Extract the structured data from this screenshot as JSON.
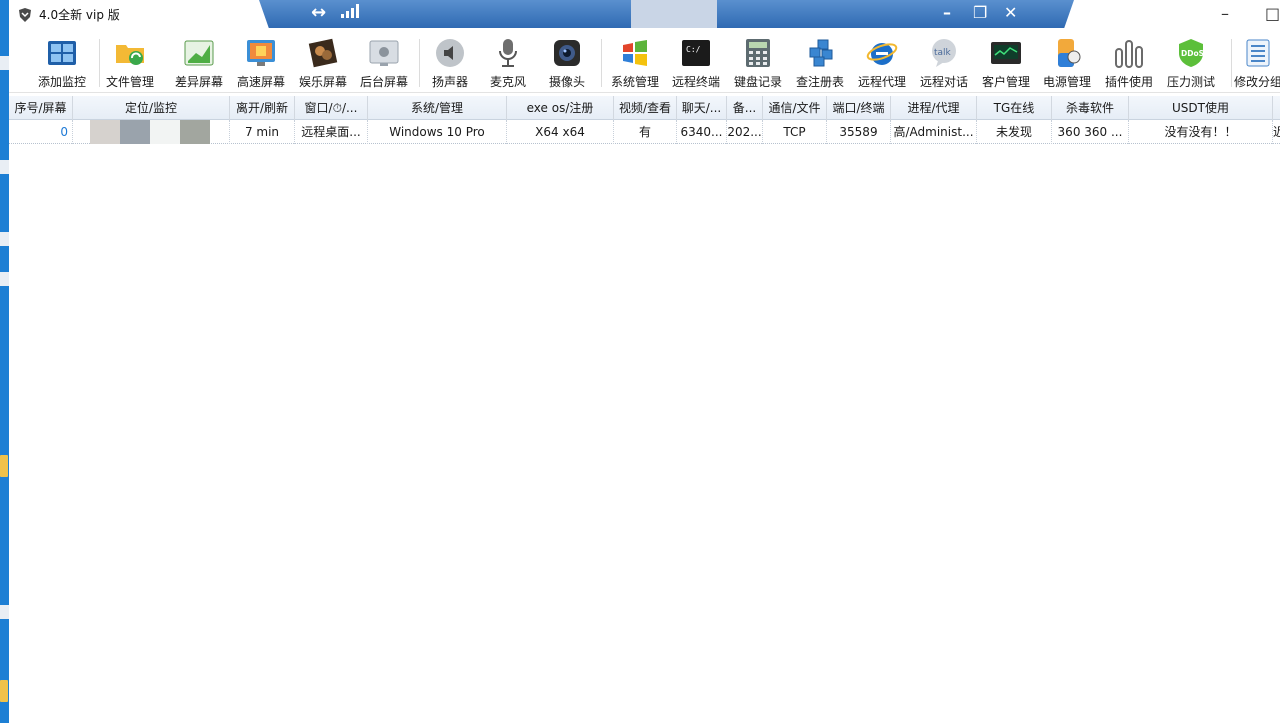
{
  "window": {
    "title": "4.0全新 vip 版",
    "remote_bar": {
      "pin": "↔",
      "minimize": "–",
      "restore": "❐",
      "close": "✕"
    },
    "minimize": "–",
    "restore": "□"
  },
  "toolbar": {
    "items": [
      {
        "label": "添加监控",
        "icon": "monitor-grid-icon"
      },
      {
        "label": "文件管理",
        "icon": "folder-sync-icon"
      },
      {
        "label": "差异屏幕",
        "icon": "chart-screen-icon"
      },
      {
        "label": "高速屏幕",
        "icon": "fast-screen-icon"
      },
      {
        "label": "娱乐屏幕",
        "icon": "entertainment-icon"
      },
      {
        "label": "后台屏幕",
        "icon": "apple-screen-icon"
      },
      {
        "label": "扬声器",
        "icon": "speaker-icon"
      },
      {
        "label": "麦克风",
        "icon": "microphone-icon"
      },
      {
        "label": "摄像头",
        "icon": "camera-icon"
      },
      {
        "label": "系统管理",
        "icon": "windows-logo-icon"
      },
      {
        "label": "远程终端",
        "icon": "terminal-icon"
      },
      {
        "label": "键盘记录",
        "icon": "calculator-keyboard-icon"
      },
      {
        "label": "查注册表",
        "icon": "registry-cubes-icon"
      },
      {
        "label": "远程代理",
        "icon": "ie-globe-icon"
      },
      {
        "label": "远程对话",
        "icon": "talk-bubble-icon"
      },
      {
        "label": "客户管理",
        "icon": "client-monitor-icon"
      },
      {
        "label": "电源管理",
        "icon": "power-battery-icon"
      },
      {
        "label": "插件使用",
        "icon": "plugin-bars-icon"
      },
      {
        "label": "压力测试",
        "icon": "ddos-shield-icon"
      },
      {
        "label": "修改分组",
        "icon": "list-doc-icon"
      }
    ],
    "ddos_text": "DDoS",
    "talk_text": "talk",
    "terminal_text": "C:/"
  },
  "grid": {
    "columns": [
      "序号/屏幕",
      "定位/监控",
      "离开/刷新",
      "窗口/⏱/...",
      "系统/管理",
      "exe os/注册",
      "视频/查看",
      "聊天/...",
      "备...",
      "通信/文件",
      "端口/终端",
      "进程/代理",
      "TG在线",
      "杀毒软件",
      "USDT使用"
    ],
    "rows": [
      {
        "cells": [
          "0",
          "",
          "7 min",
          "远程桌面...",
          "Windows 10 Pro",
          "X64 x64",
          "有",
          "6340...",
          "202...",
          "TCP",
          "35589",
          "高/Administ...",
          "未发现",
          "360 360 ...",
          "没有没有！！"
        ],
        "trailing": "近"
      }
    ],
    "index_color": "#1e7ad6"
  }
}
